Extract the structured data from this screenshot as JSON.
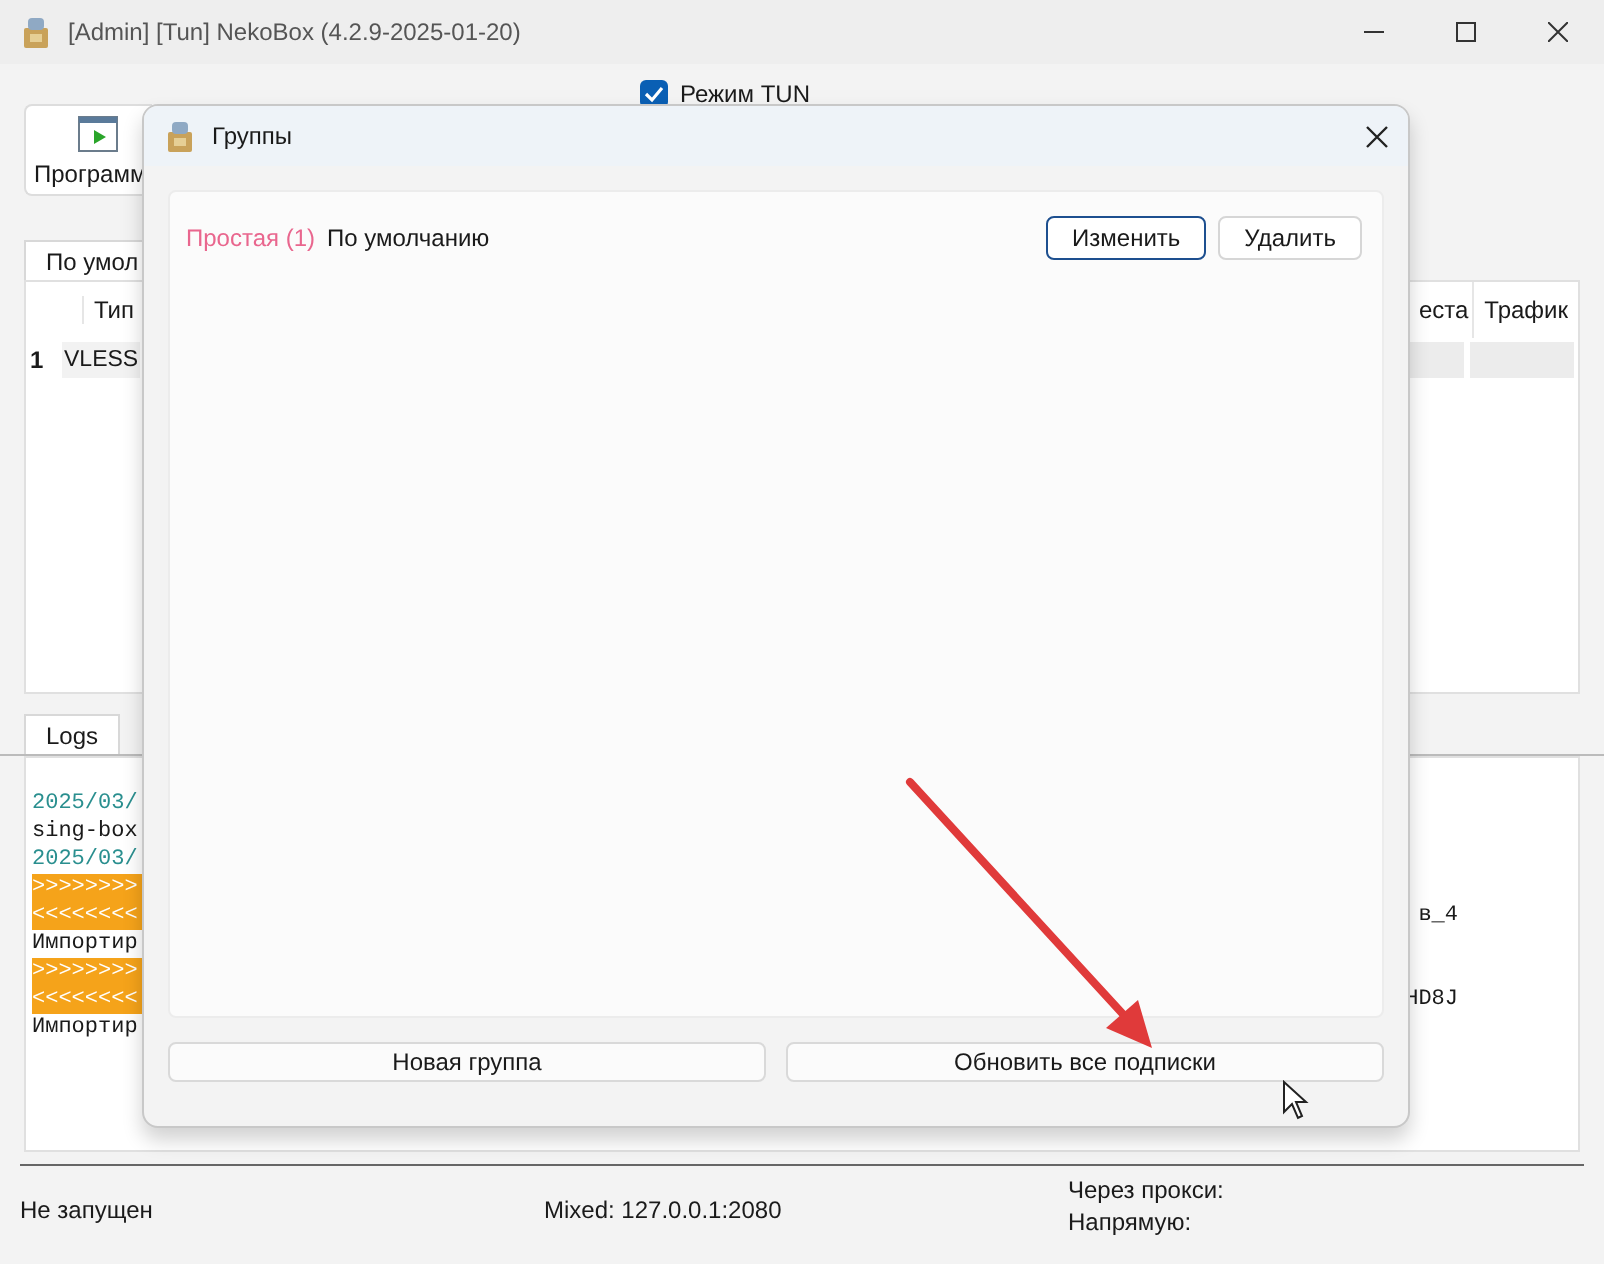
{
  "window": {
    "title": "[Admin] [Tun] NekoBox (4.2.9-2025-01-20)"
  },
  "toolbar": {
    "button": "Программ",
    "tun_mode": {
      "label": "Режим TUN",
      "checked": true
    }
  },
  "group_tabs": [
    {
      "label": "По умол",
      "selected": true
    }
  ],
  "table": {
    "columns": [
      "Тип",
      "еста",
      "Трафик"
    ],
    "rows": [
      {
        "index": "1",
        "type": "VLESS"
      }
    ]
  },
  "log_tabs": [
    {
      "label": "Logs",
      "selected": true
    }
  ],
  "log": {
    "lines": [
      {
        "kind": "time",
        "text": "2025/03/"
      },
      {
        "kind": "plain",
        "text": "sing-box"
      },
      {
        "kind": "time",
        "text": "2025/03/"
      },
      {
        "kind": "banner",
        "text": ">>>>>>>>"
      },
      {
        "kind": "banner",
        "text": "<<<<<<<<",
        "right": "в_4"
      },
      {
        "kind": "plain",
        "text": "Импортир"
      },
      {
        "kind": "banner",
        "text": ">>>>>>>>"
      },
      {
        "kind": "banner",
        "text": "<<<<<<<<",
        "right": "HD8J"
      },
      {
        "kind": "plain",
        "text": "Импортир"
      }
    ]
  },
  "status_bar": {
    "state": "Не запущен",
    "mixed": "Mixed: 127.0.0.1:2080",
    "proxy": "Через прокси:",
    "direct": "Напрямую:"
  },
  "dialog": {
    "title": "Группы",
    "groups": [
      {
        "type": "Простая (1)",
        "name": "По умолчанию",
        "actions": [
          {
            "label": "Изменить",
            "focused": true
          },
          {
            "label": "Удалить",
            "focused": false
          }
        ]
      }
    ],
    "buttons": [
      "Новая группа",
      "Обновить все подписки"
    ]
  }
}
